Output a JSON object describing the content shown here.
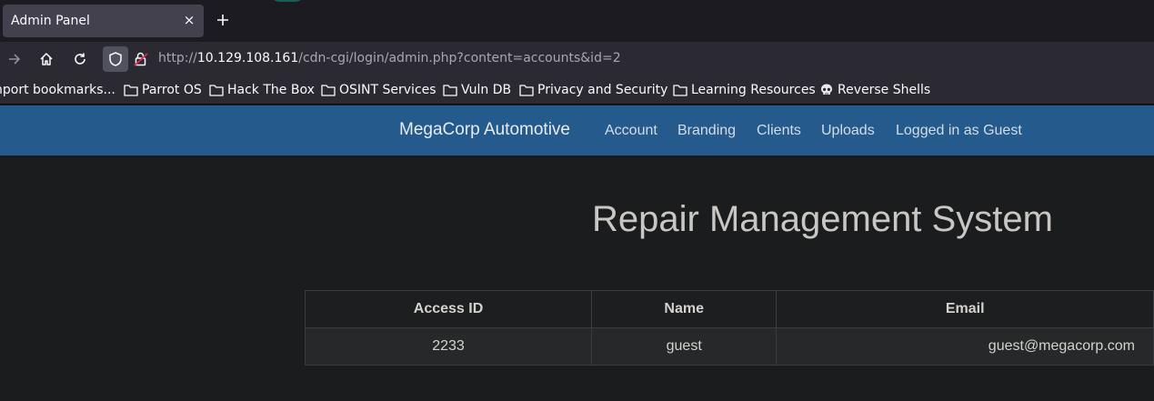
{
  "browser": {
    "tab": {
      "title": "Admin Panel",
      "close_glyph": "×"
    },
    "new_tab_icon": "plus-icon",
    "url": {
      "scheme": "http://",
      "host": "10.129.108.161",
      "path": "/cdn-cgi/login/admin.php?content=accounts&id=2"
    },
    "bookmarks": [
      {
        "label": "nport bookmarks...",
        "icon": ""
      },
      {
        "label": "Parrot OS",
        "icon": "folder-icon"
      },
      {
        "label": "Hack The Box",
        "icon": "folder-icon"
      },
      {
        "label": "OSINT Services",
        "icon": "folder-icon"
      },
      {
        "label": "Vuln DB",
        "icon": "folder-icon"
      },
      {
        "label": "Privacy and Security",
        "icon": "folder-icon"
      },
      {
        "label": "Learning Resources",
        "icon": "folder-icon"
      },
      {
        "label": "Reverse Shells",
        "icon": "skull-icon"
      }
    ]
  },
  "site": {
    "brand": "MegaCorp Automotive",
    "links": [
      "Account",
      "Branding",
      "Clients",
      "Uploads",
      "Logged in as Guest"
    ],
    "title": "Repair Management System",
    "table": {
      "headers": [
        "Access ID",
        "Name",
        "Email"
      ],
      "rows": [
        [
          "2233",
          "guest",
          "guest@megacorp.com"
        ]
      ]
    }
  },
  "colors": {
    "browser_bg": "#1c1b22",
    "toolbar_bg": "#2b2a33",
    "site_nav": "#245a8c",
    "page_bg": "#1b1c1e"
  }
}
